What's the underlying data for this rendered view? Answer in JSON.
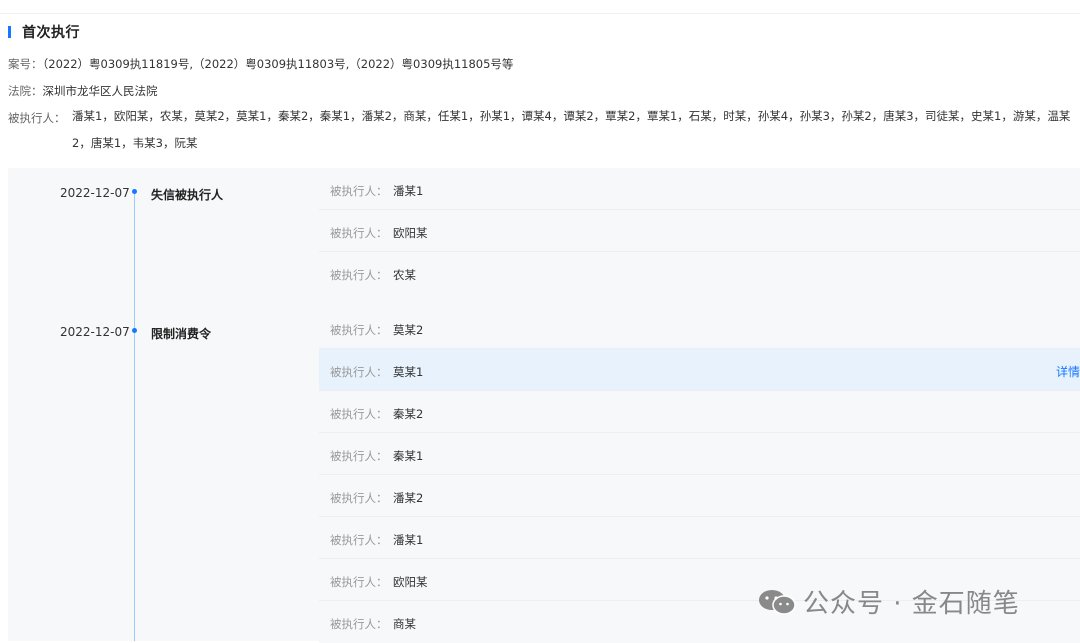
{
  "section": {
    "title": "首次执行"
  },
  "case_info": {
    "case_no_label": "案号：",
    "case_no_value": "（2022）粤0309执11819号,（2022）粤0309执11803号,（2022）粤0309执11805号等",
    "court_label": "法院：",
    "court_value": "深圳市龙华区人民法院",
    "executed_label": "被执行人：",
    "executed_value": "潘某1，欧阳某，农某，莫某2，莫某1，秦某2，秦某1，潘某2，商某，任某1，孙某1，谭某4，谭某2，覃某2，覃某1，石某，时某，孙某4，孙某3，孙某2，唐某3，司徒某，史某1，游某，温某2，唐某1，韦某3，阮某"
  },
  "timeline": [
    {
      "date": "2022-12-07",
      "type": "失信被执行人",
      "rows": [
        {
          "label": "被执行人：",
          "name": "潘某1"
        },
        {
          "label": "被执行人：",
          "name": "欧阳某"
        },
        {
          "label": "被执行人：",
          "name": "农某"
        }
      ]
    },
    {
      "date": "2022-12-07",
      "type": "限制消费令",
      "rows": [
        {
          "label": "被执行人：",
          "name": "莫某2"
        },
        {
          "label": "被执行人：",
          "name": "莫某1",
          "detail": "详情"
        },
        {
          "label": "被执行人：",
          "name": "秦某2"
        },
        {
          "label": "被执行人：",
          "name": "秦某1"
        },
        {
          "label": "被执行人：",
          "name": "潘某2"
        },
        {
          "label": "被执行人：",
          "name": "潘某1"
        },
        {
          "label": "被执行人：",
          "name": "欧阳某"
        },
        {
          "label": "被执行人：",
          "name": "商某"
        }
      ]
    }
  ],
  "watermark": {
    "text": "公众号 · 金石随笔",
    "icon": "wechat-icon"
  }
}
